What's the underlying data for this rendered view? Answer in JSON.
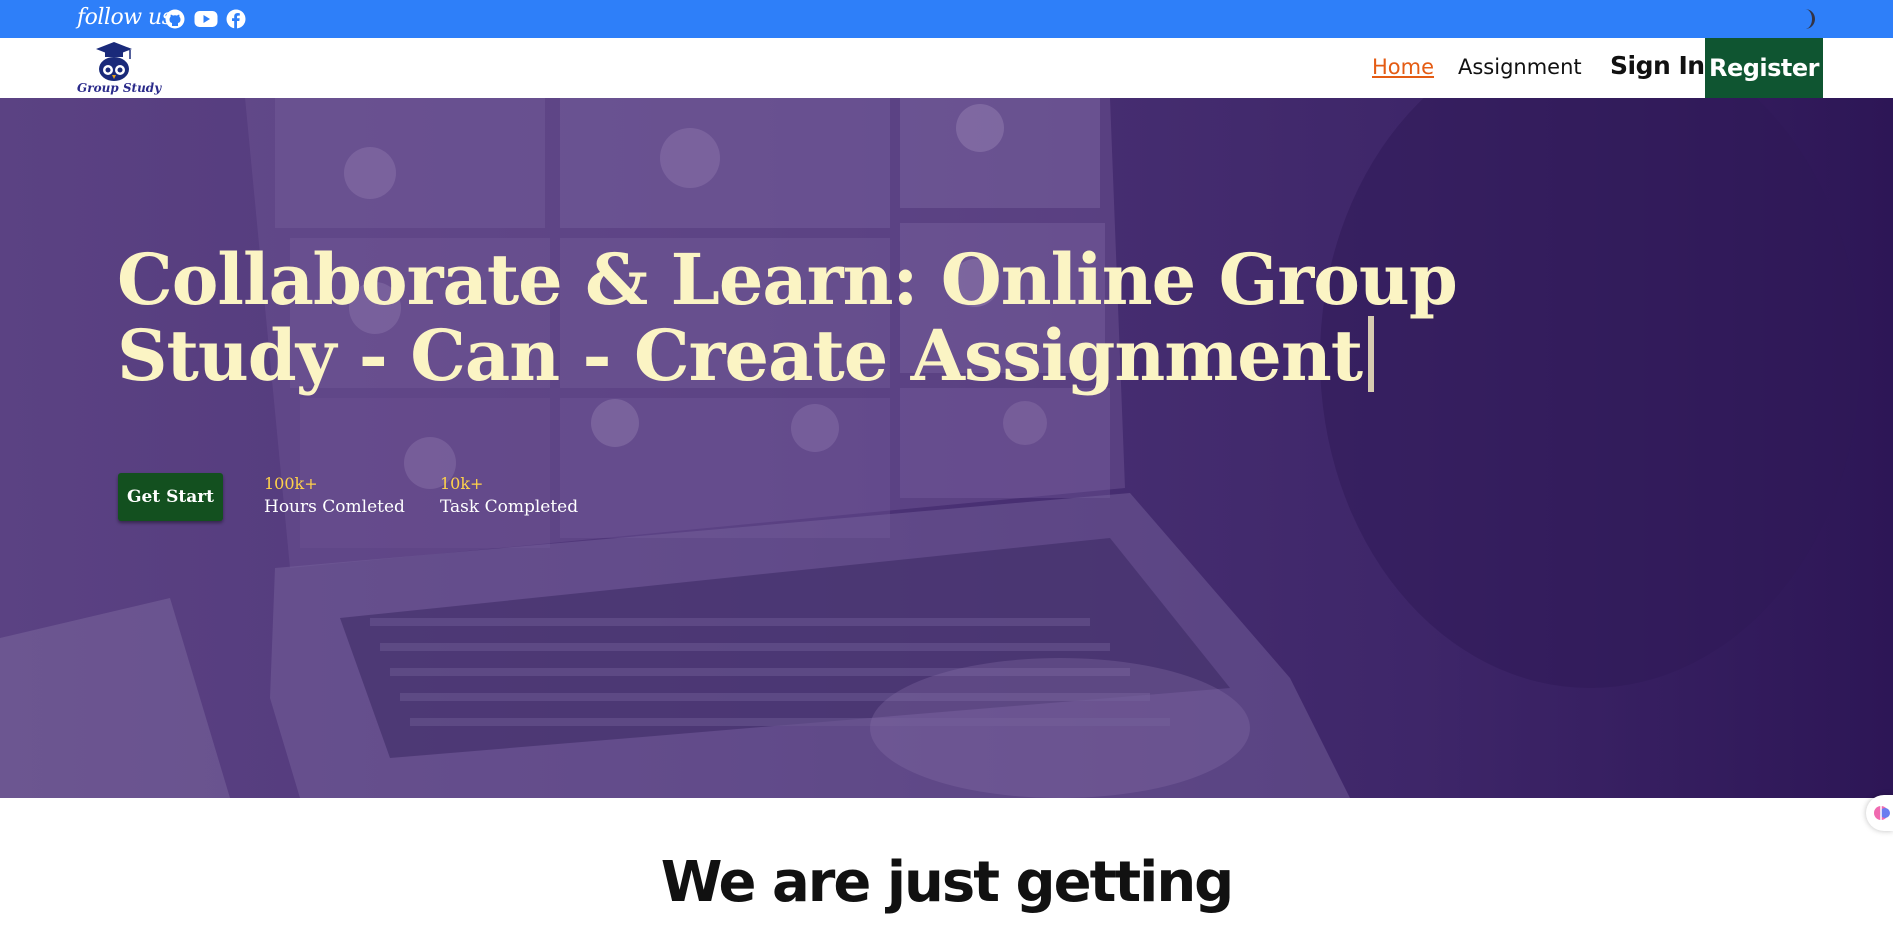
{
  "topbar": {
    "follow_text": "follow us",
    "social_icons": [
      "github-icon",
      "youtube-icon",
      "facebook-icon"
    ],
    "theme_toggle_icon": "moon-icon",
    "bg_color": "#2e7ff9"
  },
  "nav": {
    "logo_text": "Group Study",
    "home": "Home",
    "assignment": "Assignment",
    "signin": "Sign In",
    "register": "Register",
    "active_color": "#e45c14",
    "register_bg": "#0f5531"
  },
  "hero": {
    "title": "Collaborate & Learn: Online Group Study - Can - Create Assignment",
    "cta": "Get Start",
    "stats": [
      {
        "value": "100k+",
        "label": "Hours Comleted"
      },
      {
        "value": "10k+",
        "label": "Task Completed"
      }
    ],
    "title_color": "#fbf4c4"
  },
  "section": {
    "heading": "We are just getting"
  }
}
